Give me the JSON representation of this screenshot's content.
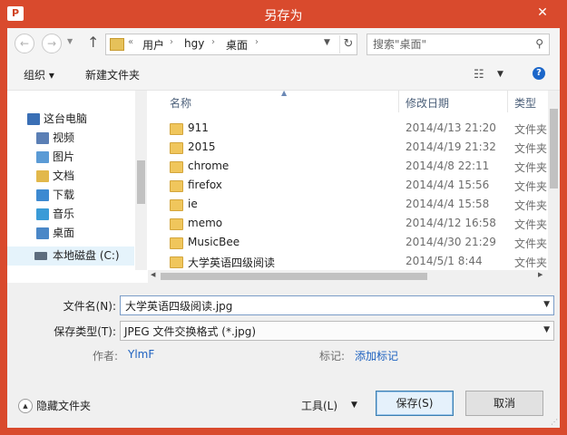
{
  "window": {
    "title": "另存为",
    "app_icon_text": "P",
    "close_label": "✕"
  },
  "nav": {
    "back_icon": "←",
    "forward_icon": "→",
    "up_icon": "↑",
    "address": {
      "prefix": "«",
      "crumbs": [
        "用户",
        "hgy",
        "桌面"
      ],
      "separator": "›",
      "refresh_icon": "↻"
    },
    "search_placeholder": "搜索\"桌面\"",
    "search_icon": "⚲"
  },
  "toolbar": {
    "organize_label": "组织 ▾",
    "new_folder_label": "新建文件夹",
    "view_icon": "☷",
    "help_icon": "?"
  },
  "sidebar": {
    "items": [
      {
        "label": "这台电脑",
        "icon": "computer-icon",
        "color": "#3a6fb5"
      },
      {
        "label": "视频",
        "icon": "videos-icon",
        "color": "#5b7fb5"
      },
      {
        "label": "图片",
        "icon": "pictures-icon",
        "color": "#5b9bd5"
      },
      {
        "label": "文档",
        "icon": "documents-icon",
        "color": "#e2b84b"
      },
      {
        "label": "下载",
        "icon": "downloads-icon",
        "color": "#3d8ad1"
      },
      {
        "label": "音乐",
        "icon": "music-icon",
        "color": "#3a9bd7"
      },
      {
        "label": "桌面",
        "icon": "desktop-icon",
        "color": "#4a87c7"
      },
      {
        "label": "本地磁盘 (C:)",
        "icon": "drive-icon",
        "color": "#5d6d7e"
      }
    ],
    "selected_index": 7
  },
  "filelist": {
    "columns": [
      "名称",
      "修改日期",
      "类型"
    ],
    "rows": [
      {
        "name": "911",
        "date": "2014/4/13 21:20",
        "type": "文件夹"
      },
      {
        "name": "2015",
        "date": "2014/4/19 21:32",
        "type": "文件夹"
      },
      {
        "name": "chrome",
        "date": "2014/4/8 22:11",
        "type": "文件夹"
      },
      {
        "name": "firefox",
        "date": "2014/4/4 15:56",
        "type": "文件夹"
      },
      {
        "name": "ie",
        "date": "2014/4/4 15:58",
        "type": "文件夹"
      },
      {
        "name": "memo",
        "date": "2014/4/12 16:58",
        "type": "文件夹"
      },
      {
        "name": "MusicBee",
        "date": "2014/4/30 21:29",
        "type": "文件夹"
      },
      {
        "name": "大学英语四级阅读",
        "date": "2014/5/1 8:44",
        "type": "文件夹"
      }
    ]
  },
  "form": {
    "filename_label": "文件名(N):",
    "filename_value": "大学英语四级阅读.jpg",
    "filetype_label": "保存类型(T):",
    "filetype_value": "JPEG 文件交换格式 (*.jpg)",
    "author_label": "作者:",
    "author_value": "YlmF",
    "tags_label": "标记:",
    "tags_value": "添加标记"
  },
  "footer": {
    "hide_folders_label": "隐藏文件夹",
    "tools_label": "工具(L)",
    "save_label": "保存(S)",
    "cancel_label": "取消"
  },
  "colors": {
    "title_bar": "#d94a2d",
    "link": "#1e62c0",
    "selection": "#e5f3fb",
    "folder": "#f0c65c"
  }
}
